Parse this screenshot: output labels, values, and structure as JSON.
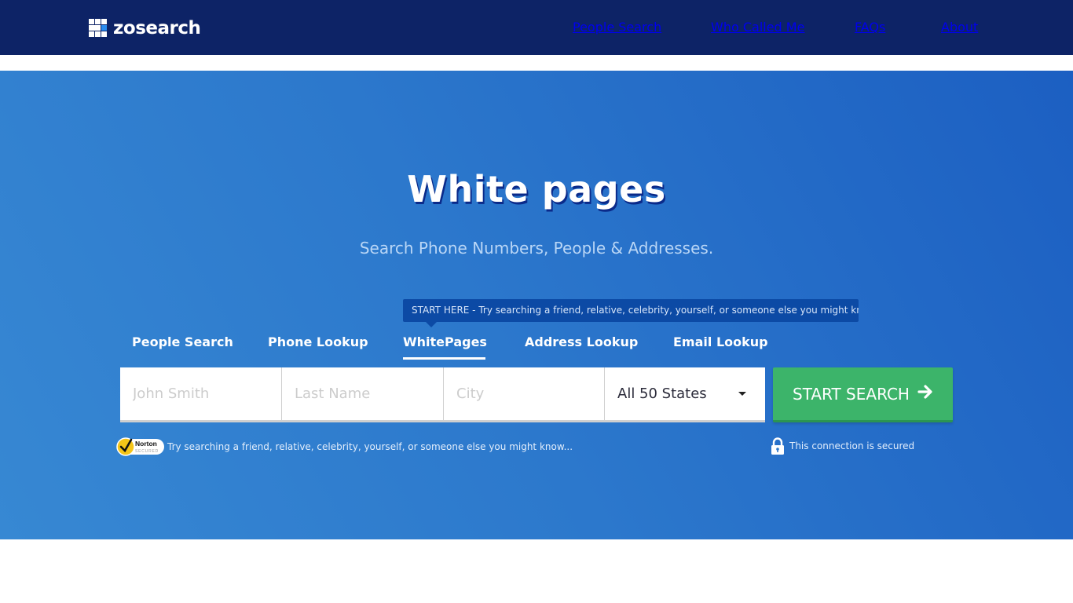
{
  "header": {
    "logo_text": "zosearch",
    "nav": [
      {
        "label": "People Search"
      },
      {
        "label": "Who Called Me"
      },
      {
        "label": "FAQs"
      },
      {
        "label": "About"
      }
    ]
  },
  "hero": {
    "title": "White pages",
    "subtitle": "Search Phone Numbers, People & Addresses.",
    "tooltip": "START HERE - Try searching a friend, relative, celebrity, yourself, or someone else you might know...",
    "tabs": [
      {
        "label": "People Search",
        "active": false
      },
      {
        "label": "Phone Lookup",
        "active": false
      },
      {
        "label": "WhitePages",
        "active": true
      },
      {
        "label": "Address Lookup",
        "active": false
      },
      {
        "label": "Email Lookup",
        "active": false
      }
    ],
    "form": {
      "first_name_placeholder": "John Smith",
      "last_name_placeholder": "Last Name",
      "city_placeholder": "City",
      "state_selected": "All 50 States",
      "submit_label": "START SEARCH",
      "submit_icon": "arrow-right-icon"
    },
    "trust_badge": {
      "line1": "Norton",
      "line2": "SECURED"
    },
    "trust_text": "Try searching a friend, relative, celebrity, yourself, or someone else you might know...",
    "secure_text": "This connection is secured"
  },
  "colors": {
    "header_bg": "#0d2366",
    "hero_gradient_start": "#3788d3",
    "hero_gradient_end": "#1c5fc2",
    "tooltip_bg": "#0c4aa5",
    "button_green": "#3cb46a",
    "logo_accent": "#2a8cf0"
  }
}
